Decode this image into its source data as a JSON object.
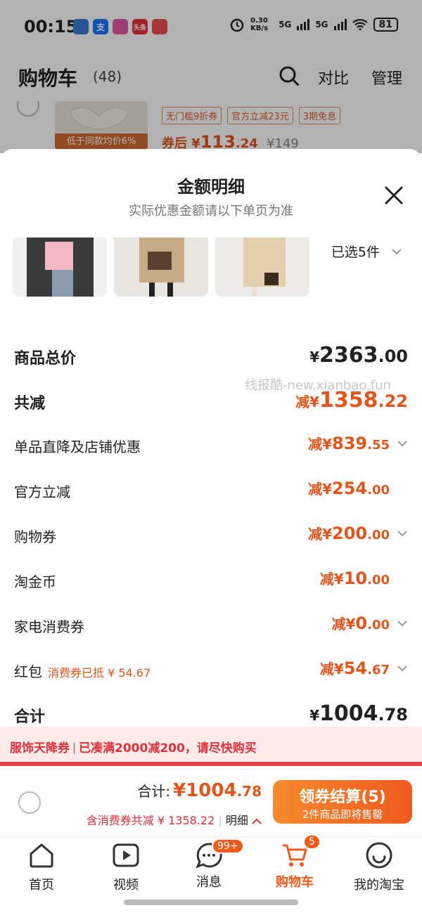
{
  "status_bar": {
    "time": "00:15",
    "network_speed": "0.30 KB/s",
    "signal1": "5G",
    "signal2": "5G",
    "battery": "81",
    "app_icons": [
      "支",
      "头条"
    ]
  },
  "header": {
    "title": "购物车",
    "count": "(48)",
    "compare": "对比",
    "manage": "管理"
  },
  "peek_item": {
    "thumb_tag": "低于同款均价6%",
    "tags": [
      "无门槛9折券",
      "官方立减23元",
      "3期免息"
    ],
    "price_prefix": "券后 ¥",
    "price_int": "113",
    "price_dec": ".24",
    "orig_price": "¥149"
  },
  "sheet": {
    "title": "金额明细",
    "subtitle": "实际优惠金额请以下单页为准",
    "selected": "已选5件",
    "watermark": "线报酷-new.xianbao.fun",
    "rows": [
      {
        "label": "商品总价",
        "pre": "¥",
        "int": "2363",
        "dec": ".00"
      },
      {
        "label": "共减",
        "pre": "减¥",
        "int": "1358",
        "dec": ".22"
      },
      {
        "label": "单品直降及店铺优惠",
        "pre": "减¥",
        "int": "839",
        "dec": ".55"
      },
      {
        "label": "官方立减",
        "pre": "减¥",
        "int": "254",
        "dec": ".00"
      },
      {
        "label": "购物券",
        "pre": "减¥",
        "int": "200",
        "dec": ".00"
      },
      {
        "label": "淘金币",
        "pre": "减¥",
        "int": "10",
        "dec": ".00"
      },
      {
        "label": "家电消费券",
        "pre": "减¥",
        "int": "0",
        "dec": ".00"
      },
      {
        "label": "红包",
        "note": "消费券已抵 ¥ 54.67",
        "pre": "减¥",
        "int": "54",
        "dec": ".67"
      },
      {
        "label": "合计",
        "pre": "¥",
        "int": "1004",
        "dec": ".78"
      }
    ]
  },
  "banner": {
    "part1": "服饰天降券",
    "part2": "已凑满2000减200，请尽快购买"
  },
  "checkout": {
    "total_label": "合计:",
    "total_pre": "¥",
    "total_int": "1004",
    "total_dec": ".78",
    "detail": "含消费券共减 ¥ 1358.22",
    "detail_link": "明细",
    "button_main": "领券结算(5)",
    "button_sub": "2件商品即将售罄"
  },
  "tabbar": {
    "tabs": [
      {
        "label": "首页"
      },
      {
        "label": "视频"
      },
      {
        "label": "消息",
        "badge": "99+"
      },
      {
        "label": "购物车",
        "badge": "5"
      },
      {
        "label": "我的淘宝"
      }
    ]
  },
  "colors": {
    "accent": "#e0561d",
    "banner_red": "#e0303a"
  }
}
